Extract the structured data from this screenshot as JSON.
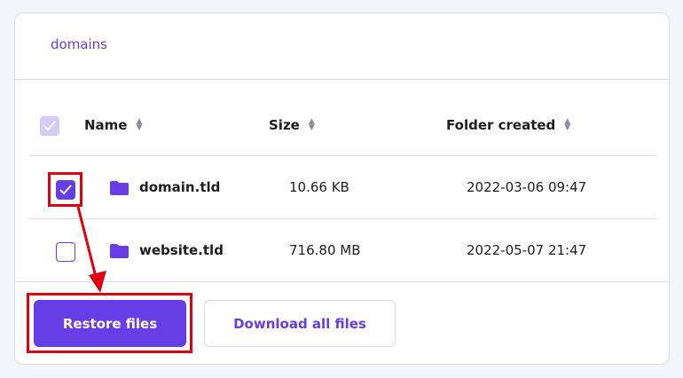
{
  "breadcrumb": "domains",
  "table": {
    "headers": [
      "Name",
      "Size",
      "Folder created"
    ],
    "rows": [
      {
        "name": "domain.tld",
        "size": "10.66 KB",
        "created": "2022-03-06 09:47",
        "checked": true
      },
      {
        "name": "website.tld",
        "size": "716.80 MB",
        "created": "2022-05-07 21:47",
        "checked": false
      }
    ]
  },
  "buttons": {
    "restore": "Restore files",
    "download": "Download all files"
  },
  "colors": {
    "accent": "#673de6",
    "annotation": "#e0000f"
  }
}
